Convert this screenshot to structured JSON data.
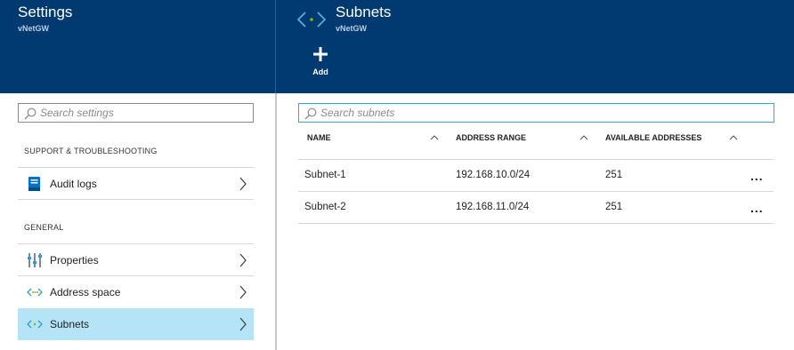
{
  "settings_blade": {
    "title": "Settings",
    "subtitle": "vNetGW",
    "search_placeholder": "Search settings",
    "sections": [
      {
        "label": "SUPPORT & TROUBLESHOOTING",
        "items": [
          {
            "label": "Audit logs",
            "icon": "audit-log-icon"
          }
        ]
      },
      {
        "label": "GENERAL",
        "items": [
          {
            "label": "Properties",
            "icon": "properties-icon"
          },
          {
            "label": "Address space",
            "icon": "address-space-icon"
          },
          {
            "label": "Subnets",
            "icon": "subnets-icon",
            "selected": true
          }
        ]
      }
    ]
  },
  "subnets_blade": {
    "title": "Subnets",
    "subtitle": "vNetGW",
    "icon": "subnets-icon",
    "commands": {
      "add_label": "Add"
    },
    "search_placeholder": "Search subnets",
    "columns": [
      "NAME",
      "ADDRESS RANGE",
      "AVAILABLE ADDRESSES"
    ],
    "rows": [
      {
        "name": "Subnet-1",
        "address_range": "192.168.10.0/24",
        "available": "251",
        "more": "..."
      },
      {
        "name": "Subnet-2",
        "address_range": "192.168.11.0/24",
        "available": "251",
        "more": "..."
      }
    ]
  },
  "colors": {
    "header_bg": "#003a70",
    "selected_item_bg": "#b4e4f6",
    "focus_border": "#39a8c8",
    "icon_teal": "#2f9fd0",
    "icon_green": "#7fba00"
  }
}
